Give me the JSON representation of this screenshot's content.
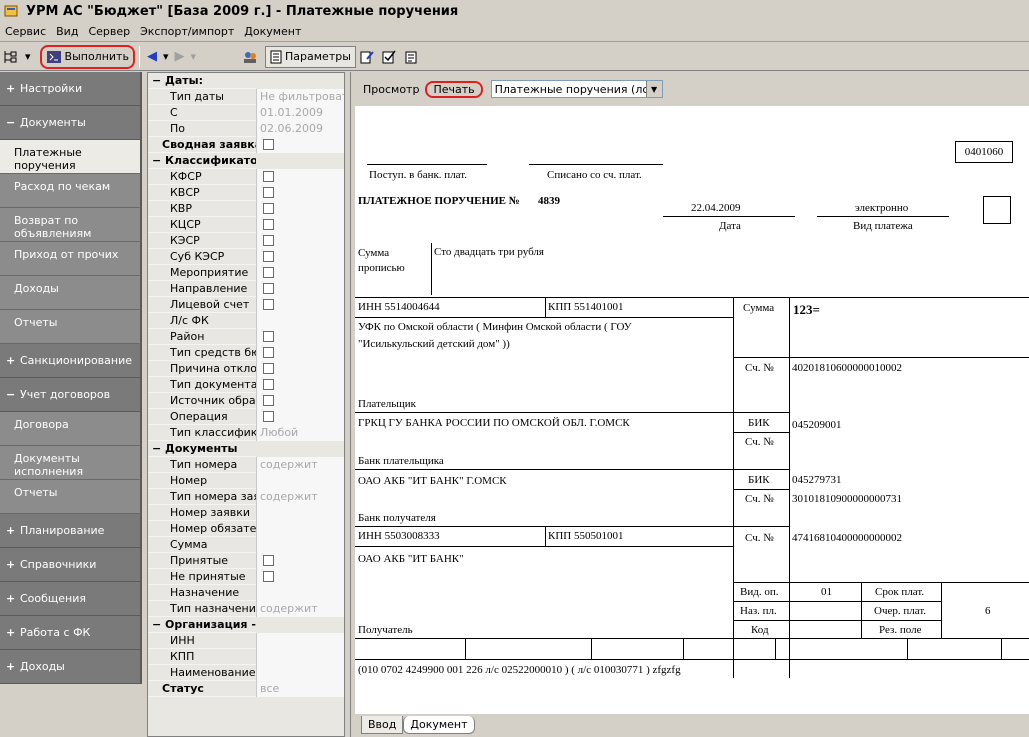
{
  "window": {
    "title": "УРМ АС \"Бюджет\" [База 2009 г.] - Платежные поручения"
  },
  "menu": [
    "Сервис",
    "Вид",
    "Сервер",
    "Экспорт/импорт",
    "Документ"
  ],
  "toolbar": {
    "execute_label": "Выполнить",
    "params_label": "Параметры"
  },
  "sidebar": {
    "items": [
      {
        "type": "group",
        "sign": "+",
        "label": "Настройки"
      },
      {
        "type": "group",
        "sign": "−",
        "label": "Документы"
      },
      {
        "type": "sub",
        "label": "Платежные поручения",
        "active": true
      },
      {
        "type": "sub",
        "label": "Расход по чекам"
      },
      {
        "type": "sub",
        "label": "Возврат по объявлениям"
      },
      {
        "type": "sub",
        "label": "Приход от прочих"
      },
      {
        "type": "sub",
        "label": "Доходы"
      },
      {
        "type": "sub",
        "label": "Отчеты"
      },
      {
        "type": "group",
        "sign": "+",
        "label": "Санкционирование"
      },
      {
        "type": "group",
        "sign": "−",
        "label": "Учет договоров"
      },
      {
        "type": "sub",
        "label": "Договора"
      },
      {
        "type": "sub",
        "label": "Документы исполнения"
      },
      {
        "type": "sub",
        "label": "Отчеты"
      },
      {
        "type": "group",
        "sign": "+",
        "label": "Планирование"
      },
      {
        "type": "group",
        "sign": "+",
        "label": "Справочники"
      },
      {
        "type": "group",
        "sign": "+",
        "label": "Сообщения"
      },
      {
        "type": "group",
        "sign": "+",
        "label": "Работа с ФК"
      },
      {
        "type": "group",
        "sign": "+",
        "label": "Доходы"
      }
    ]
  },
  "filters": [
    {
      "kind": "section",
      "label": "Даты:"
    },
    {
      "kind": "value",
      "label": "Тип даты",
      "value": "Не фильтровать"
    },
    {
      "kind": "value",
      "label": "С",
      "value": "01.01.2009"
    },
    {
      "kind": "value",
      "label": "По",
      "value": "02.06.2009"
    },
    {
      "kind": "boldcheck",
      "label": "Сводная заявка"
    },
    {
      "kind": "section",
      "label": "Классификатор"
    },
    {
      "kind": "check",
      "label": "КФСР"
    },
    {
      "kind": "check",
      "label": "КВСР"
    },
    {
      "kind": "check",
      "label": "КВР"
    },
    {
      "kind": "check",
      "label": "КЦСР"
    },
    {
      "kind": "check",
      "label": "КЭСР"
    },
    {
      "kind": "check",
      "label": "Суб КЭСР"
    },
    {
      "kind": "check",
      "label": "Мероприятие"
    },
    {
      "kind": "check",
      "label": "Направление"
    },
    {
      "kind": "check",
      "label": "Лицевой счет"
    },
    {
      "kind": "value",
      "label": "Л/с ФК",
      "value": ""
    },
    {
      "kind": "check",
      "label": "Район"
    },
    {
      "kind": "check",
      "label": "Тип средств бюджета"
    },
    {
      "kind": "check",
      "label": "Причина отклонения"
    },
    {
      "kind": "check",
      "label": "Тип документа основания"
    },
    {
      "kind": "check",
      "label": "Источник образования"
    },
    {
      "kind": "check",
      "label": "Операция"
    },
    {
      "kind": "value",
      "label": "Тип классификатора",
      "value": "Любой"
    },
    {
      "kind": "section",
      "label": "Документы"
    },
    {
      "kind": "value",
      "label": "Тип номера",
      "value": "содержит"
    },
    {
      "kind": "value",
      "label": "Номер",
      "value": ""
    },
    {
      "kind": "value",
      "label": "Тип номера заявки",
      "value": "содержит"
    },
    {
      "kind": "value",
      "label": "Номер заявки",
      "value": ""
    },
    {
      "kind": "value",
      "label": "Номер обязательства",
      "value": ""
    },
    {
      "kind": "value",
      "label": "Сумма",
      "value": ""
    },
    {
      "kind": "check",
      "label": "Принятые"
    },
    {
      "kind": "check",
      "label": "Не принятые"
    },
    {
      "kind": "value",
      "label": "Назначение",
      "value": ""
    },
    {
      "kind": "value",
      "label": "Тип назначения",
      "value": "содержит"
    },
    {
      "kind": "section",
      "label": "Организация - плательщик"
    },
    {
      "kind": "value",
      "label": "ИНН",
      "value": ""
    },
    {
      "kind": "value",
      "label": "КПП",
      "value": ""
    },
    {
      "kind": "value",
      "label": "Наименование",
      "value": ""
    },
    {
      "kind": "boldvalue",
      "label": "Статус",
      "value": "все"
    }
  ],
  "doc_toolbar": {
    "preview": "Просмотр",
    "print": "Печать",
    "form": "Платежные поручения (лс ФС)"
  },
  "doc": {
    "okud": "0401060",
    "received": "Поступ. в банк. плат.",
    "debited": "Списано со сч. плат.",
    "title": "ПЛАТЕЖНОЕ ПОРУЧЕНИЕ №",
    "number": "4839",
    "date": "22.04.2009",
    "date_label": "Дата",
    "payment_type": "электронно",
    "payment_type_label": "Вид платежа",
    "sum_words_label": "Сумма прописью",
    "sum_words": "Сто двадцать три рубля",
    "payer_inn": "ИНН 5514004644",
    "payer_kpp": "КПП 551401001",
    "sum_label": "Сумма",
    "sum": "123=",
    "payer_name_1": "УФК по Омской области ( Минфин Омской области ( ГОУ",
    "payer_name_2": "\"Исилькульский детский дом\" ))",
    "account_label": "Сч. №",
    "payer_account": "40201810600000010002",
    "payer_label": "Плательщик",
    "payer_bank": "ГРКЦ ГУ БАНКА РОССИИ ПО ОМСКОЙ ОБЛ. Г.ОМСК",
    "bik_label": "БИК",
    "payer_bik": "045209001",
    "payer_bank_label": "Банк плательщика",
    "recipient_bank": "ОАО АКБ \"ИТ БАНК\" Г.ОМСК",
    "recipient_bik": "045279731",
    "recipient_corr": "30101810900000000731",
    "recipient_bank_label": "Банк получателя",
    "recipient_inn": "ИНН 5503008333",
    "recipient_kpp": "КПП 550501001",
    "recipient_account": "47416810400000000002",
    "recipient_name": "ОАО АКБ \"ИТ БАНК\"",
    "op_type_label": "Вид. оп.",
    "op_type": "01",
    "term_label": "Срок плат.",
    "purpose_label": "Наз. пл.",
    "priority_label": "Очер. плат.",
    "priority": "6",
    "code_label": "Код",
    "reserve_label": "Рез. поле",
    "recipient_label": "Получатель",
    "purpose": "(010 0702 4249900 001 226 л/с 02522000010 ) ( л/с 010030771 ) zfgzfg"
  },
  "tabs": [
    "Ввод",
    "Документ"
  ]
}
